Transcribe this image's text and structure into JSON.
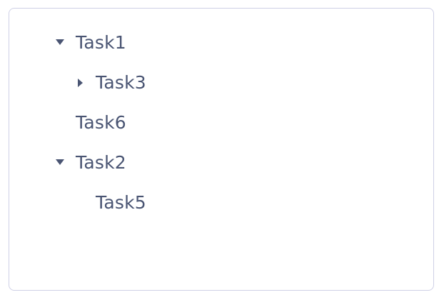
{
  "tree": {
    "nodes": [
      {
        "id": "task1",
        "label": "Task1",
        "level": 0,
        "expandable": true,
        "expanded": true,
        "toggle_icon": "caret-down-icon"
      },
      {
        "id": "task3",
        "label": "Task3",
        "level": 1,
        "expandable": true,
        "expanded": false,
        "toggle_icon": "caret-right-icon"
      },
      {
        "id": "task6",
        "label": "Task6",
        "level": 0,
        "expandable": false,
        "expanded": false
      },
      {
        "id": "task2",
        "label": "Task2",
        "level": 0,
        "expandable": true,
        "expanded": true,
        "toggle_icon": "caret-down-icon"
      },
      {
        "id": "task5",
        "label": "Task5",
        "level": 1,
        "expandable": false,
        "expanded": false
      }
    ]
  },
  "colors": {
    "text": "#4a5573",
    "border": "#cfd0e6",
    "background": "#ffffff"
  }
}
